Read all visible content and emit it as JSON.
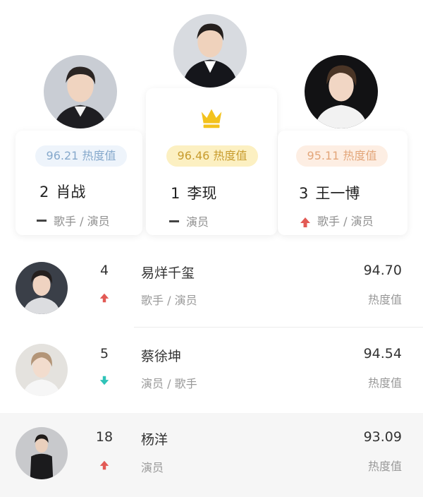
{
  "top3": [
    {
      "rank": "2",
      "name": "肖战",
      "heat": "96.21 热度值",
      "tags": "歌手 / 演员",
      "trend": "flat",
      "avatar": "person-avatar-icon"
    },
    {
      "rank": "1",
      "name": "李现",
      "heat": "96.46 热度值",
      "tags": "演员",
      "trend": "flat",
      "avatar": "person-avatar-icon",
      "badge": "crown-icon"
    },
    {
      "rank": "3",
      "name": "王一博",
      "heat": "95.11 热度值",
      "tags": "歌手 / 演员",
      "trend": "up",
      "avatar": "person-avatar-icon"
    }
  ],
  "list": [
    {
      "rank": "4",
      "name": "易烊千玺",
      "tags": "歌手 / 演员",
      "score": "94.70",
      "unit": "热度值",
      "trend": "up"
    },
    {
      "rank": "5",
      "name": "蔡徐坤",
      "tags": "演员 / 歌手",
      "score": "94.54",
      "unit": "热度值",
      "trend": "down"
    },
    {
      "rank": "18",
      "name": "杨洋",
      "tags": "演员",
      "score": "93.09",
      "unit": "热度值",
      "trend": "up"
    }
  ],
  "colors": {
    "up": "#e25a55",
    "down": "#2fc3b8",
    "flat": "#444444",
    "crown": "#f3c21d",
    "gold_pill": "#fcf0c2",
    "silver_pill": "#eef4fb",
    "bronze_pill": "#fdeee3"
  }
}
